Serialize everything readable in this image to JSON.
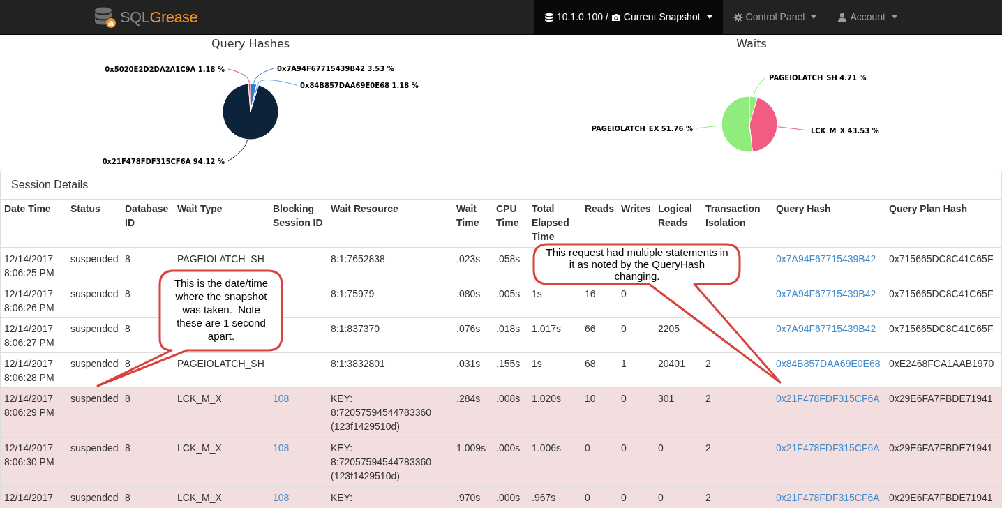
{
  "navbar": {
    "brand": {
      "first": "SQL",
      "second": "Grease"
    },
    "items": [
      {
        "kind": "connection",
        "server": "10.1.0.100",
        "separator": "/",
        "label": "Current Snapshot",
        "selected": true
      },
      {
        "kind": "settings",
        "label": "Control Panel",
        "selected": false
      },
      {
        "kind": "account",
        "label": "Account",
        "selected": false
      }
    ]
  },
  "charts": [
    {
      "chart_data": {
        "type": "pie",
        "title": "Query Hashes",
        "categories": [
          "0x7A94F67715439B42",
          "0x84B857DAA69E0E68",
          "0x21F478FDF315CF6A",
          "0x5020E2D2DA2A1C9A"
        ],
        "values": [
          3.53,
          1.18,
          94.12,
          1.18
        ],
        "colors": [
          "#2f7ed8",
          "#5aa6ea",
          "#0d233a",
          "#d9534f"
        ],
        "value_labels": [
          "3.53 %",
          "1.18 %",
          "94.12 %",
          "1.18 %"
        ]
      }
    },
    {
      "chart_data": {
        "type": "pie",
        "title": "Waits",
        "categories": [
          "PAGEIOLATCH_SH",
          "LCK_M_X",
          "PAGEIOLATCH_EX"
        ],
        "values": [
          4.71,
          43.53,
          51.76
        ],
        "colors": [
          "#90ed7d",
          "#f15c80",
          "#90ed7d"
        ],
        "value_labels": [
          "4.71 %",
          "43.53 %",
          "51.76 %"
        ]
      }
    }
  ],
  "session_details": {
    "title": "Session Details",
    "columns": [
      {
        "label": "Date Time",
        "link": false
      },
      {
        "label": "Status",
        "link": false
      },
      {
        "label": "Database ID",
        "link": false
      },
      {
        "label": "Wait Type",
        "link": false
      },
      {
        "label": "Blocking Session ID",
        "link": true
      },
      {
        "label": "Wait Resource",
        "link": false
      },
      {
        "label": "Wait Time",
        "link": false
      },
      {
        "label": "CPU Time",
        "link": false
      },
      {
        "label": "Total Elapsed Time",
        "link": false
      },
      {
        "label": "Reads",
        "link": false
      },
      {
        "label": "Writes",
        "link": false
      },
      {
        "label": "Logical Reads",
        "link": false
      },
      {
        "label": "Transaction Isolation",
        "link": false
      },
      {
        "label": "Query Hash",
        "link": true
      },
      {
        "label": "Query Plan Hash",
        "link": false
      }
    ],
    "rows": [
      {
        "highlighted": false,
        "cells": [
          "12/14/2017 8:06:25 PM",
          "suspended",
          "8",
          "PAGEIOLATCH_SH",
          null,
          "8:1:7652838",
          ".023s",
          ".058s",
          null,
          null,
          null,
          null,
          null,
          "0x7A94F67715439B42",
          "0x715665DC8C41C65F"
        ]
      },
      {
        "highlighted": false,
        "cells": [
          "12/14/2017 8:06:26 PM",
          "suspended",
          "8",
          null,
          null,
          "8:1:75979",
          ".080s",
          ".005s",
          "1s",
          "16",
          "0",
          null,
          null,
          "0x7A94F67715439B42",
          "0x715665DC8C41C65F"
        ]
      },
      {
        "highlighted": false,
        "cells": [
          "12/14/2017 8:06:27 PM",
          "suspended",
          "8",
          null,
          null,
          "8:1:837370",
          ".076s",
          ".018s",
          "1.017s",
          "66",
          "0",
          "2205",
          null,
          "0x7A94F67715439B42",
          "0x715665DC8C41C65F"
        ]
      },
      {
        "highlighted": false,
        "cells": [
          "12/14/2017 8:06:28 PM",
          "suspended",
          "8",
          "PAGEIOLATCH_SH",
          null,
          "8:1:3832801",
          ".031s",
          ".155s",
          "1s",
          "68",
          "1",
          "20401",
          "2",
          "0x84B857DAA69E0E68",
          "0xE2468FCA1AAB1970"
        ]
      },
      {
        "highlighted": true,
        "cells": [
          "12/14/2017 8:06:29 PM",
          "suspended",
          "8",
          "LCK_M_X",
          "108",
          "KEY: 8:72057594544783360 (123f1429510d)",
          ".284s",
          ".008s",
          "1.020s",
          "10",
          "0",
          "301",
          "2",
          "0x21F478FDF315CF6A",
          "0x29E6FA7FBDE71941"
        ]
      },
      {
        "highlighted": true,
        "cells": [
          "12/14/2017 8:06:30 PM",
          "suspended",
          "8",
          "LCK_M_X",
          "108",
          "KEY: 8:72057594544783360 (123f1429510d)",
          "1.009s",
          ".000s",
          "1.006s",
          "0",
          "0",
          "0",
          "2",
          "0x21F478FDF315CF6A",
          "0x29E6FA7FBDE71941"
        ]
      },
      {
        "highlighted": true,
        "cells": [
          "12/14/2017",
          "suspended",
          "8",
          "LCK_M_X",
          "108",
          "KEY:",
          ".970s",
          ".000s",
          ".967s",
          "0",
          "0",
          "0",
          "2",
          "0x21F478FDF315CF6A",
          "0x29E6FA7FBDE71941"
        ]
      }
    ]
  },
  "callouts": [
    {
      "text": "This is the date/time where the snapshot was taken.  Note these are 1 second apart."
    },
    {
      "text": "This request had multiple statements in it as noted by the QueryHash changing."
    }
  ]
}
